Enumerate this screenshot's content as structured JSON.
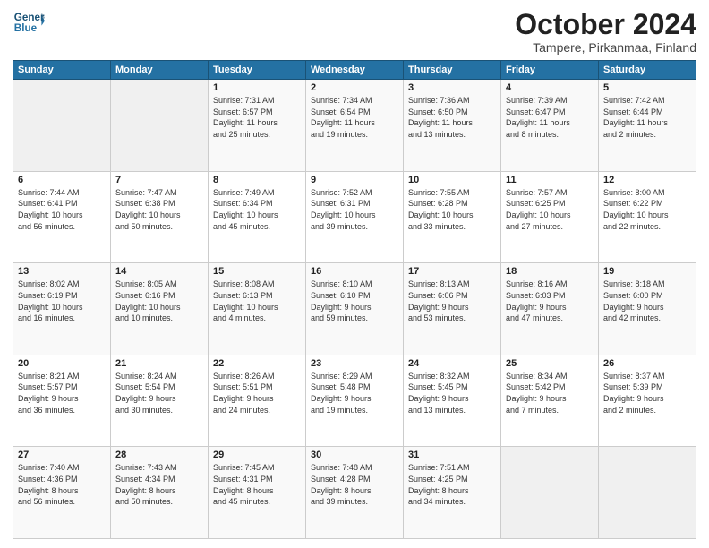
{
  "header": {
    "logo_text_general": "General",
    "logo_text_blue": "Blue",
    "month_title": "October 2024",
    "subtitle": "Tampere, Pirkanmaa, Finland"
  },
  "days_of_week": [
    "Sunday",
    "Monday",
    "Tuesday",
    "Wednesday",
    "Thursday",
    "Friday",
    "Saturday"
  ],
  "weeks": [
    [
      {
        "day": "",
        "info": ""
      },
      {
        "day": "",
        "info": ""
      },
      {
        "day": "1",
        "info": "Sunrise: 7:31 AM\nSunset: 6:57 PM\nDaylight: 11 hours\nand 25 minutes."
      },
      {
        "day": "2",
        "info": "Sunrise: 7:34 AM\nSunset: 6:54 PM\nDaylight: 11 hours\nand 19 minutes."
      },
      {
        "day": "3",
        "info": "Sunrise: 7:36 AM\nSunset: 6:50 PM\nDaylight: 11 hours\nand 13 minutes."
      },
      {
        "day": "4",
        "info": "Sunrise: 7:39 AM\nSunset: 6:47 PM\nDaylight: 11 hours\nand 8 minutes."
      },
      {
        "day": "5",
        "info": "Sunrise: 7:42 AM\nSunset: 6:44 PM\nDaylight: 11 hours\nand 2 minutes."
      }
    ],
    [
      {
        "day": "6",
        "info": "Sunrise: 7:44 AM\nSunset: 6:41 PM\nDaylight: 10 hours\nand 56 minutes."
      },
      {
        "day": "7",
        "info": "Sunrise: 7:47 AM\nSunset: 6:38 PM\nDaylight: 10 hours\nand 50 minutes."
      },
      {
        "day": "8",
        "info": "Sunrise: 7:49 AM\nSunset: 6:34 PM\nDaylight: 10 hours\nand 45 minutes."
      },
      {
        "day": "9",
        "info": "Sunrise: 7:52 AM\nSunset: 6:31 PM\nDaylight: 10 hours\nand 39 minutes."
      },
      {
        "day": "10",
        "info": "Sunrise: 7:55 AM\nSunset: 6:28 PM\nDaylight: 10 hours\nand 33 minutes."
      },
      {
        "day": "11",
        "info": "Sunrise: 7:57 AM\nSunset: 6:25 PM\nDaylight: 10 hours\nand 27 minutes."
      },
      {
        "day": "12",
        "info": "Sunrise: 8:00 AM\nSunset: 6:22 PM\nDaylight: 10 hours\nand 22 minutes."
      }
    ],
    [
      {
        "day": "13",
        "info": "Sunrise: 8:02 AM\nSunset: 6:19 PM\nDaylight: 10 hours\nand 16 minutes."
      },
      {
        "day": "14",
        "info": "Sunrise: 8:05 AM\nSunset: 6:16 PM\nDaylight: 10 hours\nand 10 minutes."
      },
      {
        "day": "15",
        "info": "Sunrise: 8:08 AM\nSunset: 6:13 PM\nDaylight: 10 hours\nand 4 minutes."
      },
      {
        "day": "16",
        "info": "Sunrise: 8:10 AM\nSunset: 6:10 PM\nDaylight: 9 hours\nand 59 minutes."
      },
      {
        "day": "17",
        "info": "Sunrise: 8:13 AM\nSunset: 6:06 PM\nDaylight: 9 hours\nand 53 minutes."
      },
      {
        "day": "18",
        "info": "Sunrise: 8:16 AM\nSunset: 6:03 PM\nDaylight: 9 hours\nand 47 minutes."
      },
      {
        "day": "19",
        "info": "Sunrise: 8:18 AM\nSunset: 6:00 PM\nDaylight: 9 hours\nand 42 minutes."
      }
    ],
    [
      {
        "day": "20",
        "info": "Sunrise: 8:21 AM\nSunset: 5:57 PM\nDaylight: 9 hours\nand 36 minutes."
      },
      {
        "day": "21",
        "info": "Sunrise: 8:24 AM\nSunset: 5:54 PM\nDaylight: 9 hours\nand 30 minutes."
      },
      {
        "day": "22",
        "info": "Sunrise: 8:26 AM\nSunset: 5:51 PM\nDaylight: 9 hours\nand 24 minutes."
      },
      {
        "day": "23",
        "info": "Sunrise: 8:29 AM\nSunset: 5:48 PM\nDaylight: 9 hours\nand 19 minutes."
      },
      {
        "day": "24",
        "info": "Sunrise: 8:32 AM\nSunset: 5:45 PM\nDaylight: 9 hours\nand 13 minutes."
      },
      {
        "day": "25",
        "info": "Sunrise: 8:34 AM\nSunset: 5:42 PM\nDaylight: 9 hours\nand 7 minutes."
      },
      {
        "day": "26",
        "info": "Sunrise: 8:37 AM\nSunset: 5:39 PM\nDaylight: 9 hours\nand 2 minutes."
      }
    ],
    [
      {
        "day": "27",
        "info": "Sunrise: 7:40 AM\nSunset: 4:36 PM\nDaylight: 8 hours\nand 56 minutes."
      },
      {
        "day": "28",
        "info": "Sunrise: 7:43 AM\nSunset: 4:34 PM\nDaylight: 8 hours\nand 50 minutes."
      },
      {
        "day": "29",
        "info": "Sunrise: 7:45 AM\nSunset: 4:31 PM\nDaylight: 8 hours\nand 45 minutes."
      },
      {
        "day": "30",
        "info": "Sunrise: 7:48 AM\nSunset: 4:28 PM\nDaylight: 8 hours\nand 39 minutes."
      },
      {
        "day": "31",
        "info": "Sunrise: 7:51 AM\nSunset: 4:25 PM\nDaylight: 8 hours\nand 34 minutes."
      },
      {
        "day": "",
        "info": ""
      },
      {
        "day": "",
        "info": ""
      }
    ]
  ]
}
